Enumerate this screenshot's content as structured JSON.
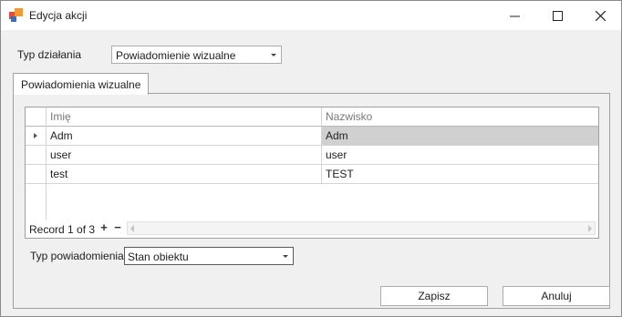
{
  "window": {
    "title": "Edycja akcji",
    "icon_name": "app-squares-icon",
    "colors": {
      "icon_red": "#e44b3a",
      "icon_orange": "#f19a34",
      "icon_blue": "#3d6fb6",
      "selected_row": "#d0d0d0"
    }
  },
  "form": {
    "action_type_label": "Typ działania",
    "action_type_value": "Powiadomienie wizualne"
  },
  "tabs": [
    {
      "label": "Powiadomienia wizualne"
    }
  ],
  "grid": {
    "columns": [
      "Imię",
      "Nazwisko"
    ],
    "rows": [
      {
        "first_name": "Adm",
        "last_name": "Adm",
        "selected": true
      },
      {
        "first_name": "user",
        "last_name": "user",
        "selected": false
      },
      {
        "first_name": "test",
        "last_name": "TEST",
        "selected": false
      }
    ],
    "navigator": {
      "record_text": "Record 1 of 3",
      "add_symbol": "+",
      "remove_symbol": "−"
    }
  },
  "notification": {
    "type_label": "Typ powiadomienia",
    "type_value": "Stan obiektu"
  },
  "buttons": {
    "save_label": "Zapisz",
    "cancel_label": "Anuluj"
  }
}
